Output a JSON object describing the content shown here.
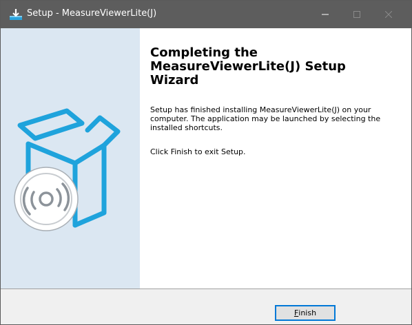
{
  "window": {
    "title": "Setup - MeasureViewerLite(J)",
    "titlebar_color": "#5d5d5d",
    "icon": "setup-installer-icon"
  },
  "caption_buttons": {
    "minimize_icon": "minimize-icon",
    "maximize_icon": "maximize-icon",
    "close_icon": "close-icon"
  },
  "wizard": {
    "heading": "Completing the MeasureViewerLite(J) Setup Wizard",
    "paragraph1": "Setup has finished installing MeasureViewerLite(J) on your computer. The application may be launched by selecting the installed shortcuts.",
    "paragraph2": "Click Finish to exit Setup.",
    "graphic": "software-box-with-disc-icon",
    "accent_color": "#1fa3dc",
    "panel_color": "#dbe7f2"
  },
  "buttons": {
    "finish_accel": "F",
    "finish_rest": "inish"
  }
}
